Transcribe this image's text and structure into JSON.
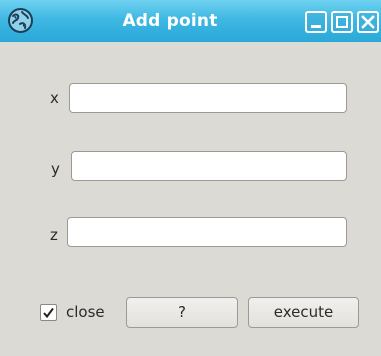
{
  "window": {
    "title": "Add point",
    "app_icon": "globe-icon",
    "controls": {
      "minimize_icon": "minimize-icon",
      "maximize_icon": "maximize-icon",
      "close_icon": "close-icon"
    }
  },
  "form": {
    "fields": [
      {
        "label": "x",
        "value": ""
      },
      {
        "label": "y",
        "value": ""
      },
      {
        "label": "z",
        "value": ""
      }
    ]
  },
  "footer": {
    "close_checkbox": {
      "label": "close",
      "checked": true
    },
    "help_button": "?",
    "execute_button": "execute"
  },
  "colors": {
    "titlebar": "#3fb8e3",
    "window_bg": "#dcdad5",
    "title_text": "#ffffff"
  }
}
